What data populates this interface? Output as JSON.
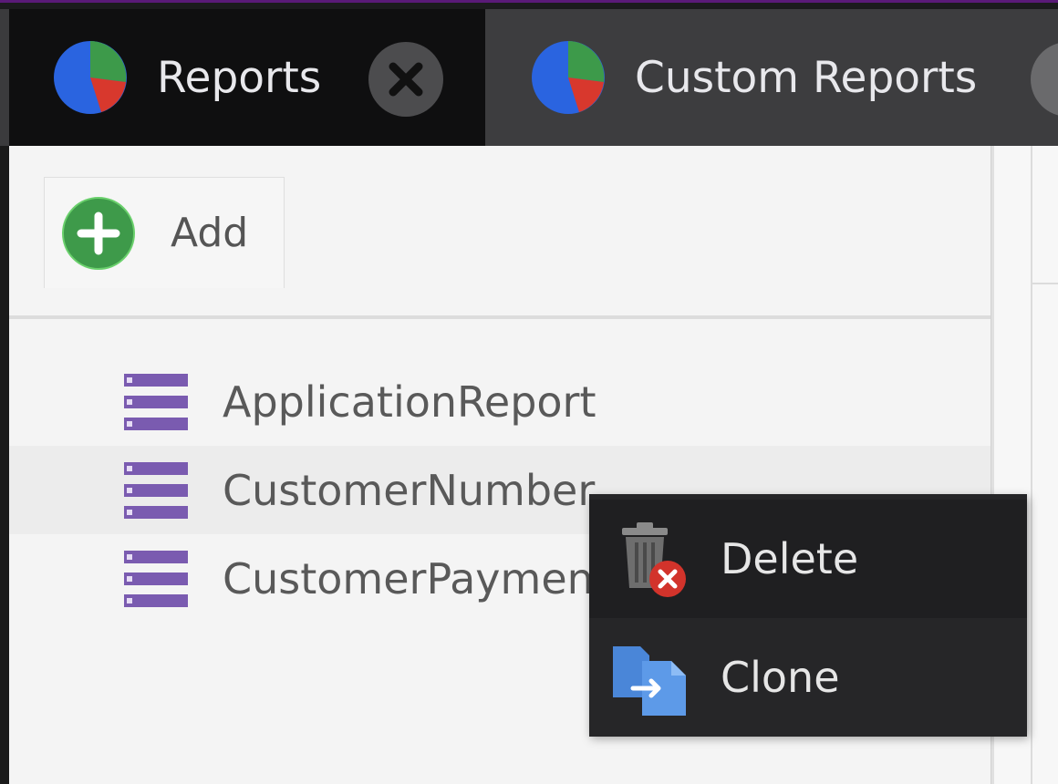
{
  "tabs": [
    {
      "label": "Reports",
      "active": true,
      "icon": "pie-chart-icon"
    },
    {
      "label": "Custom Reports",
      "active": false,
      "icon": "pie-chart-icon"
    }
  ],
  "toolbar": {
    "add_label": "Add",
    "add_icon": "add-circle-icon"
  },
  "reports": [
    {
      "label": "ApplicationReport",
      "icon": "report-list-icon"
    },
    {
      "label": "CustomerNumber",
      "icon": "report-list-icon"
    },
    {
      "label": "CustomerPayments",
      "icon": "report-list-icon"
    }
  ],
  "context_menu": {
    "items": [
      {
        "label": "Delete",
        "icon": "trash-delete-icon"
      },
      {
        "label": "Clone",
        "icon": "clone-icon"
      }
    ]
  },
  "colors": {
    "accent_top": "#5a1a78",
    "tab_active_bg": "#0f0f10",
    "tab_inactive_bg": "#3d3d3f",
    "add_green": "#3e9a4a",
    "report_icon_purple": "#7a5bb0",
    "menu_bg": "#262628"
  }
}
